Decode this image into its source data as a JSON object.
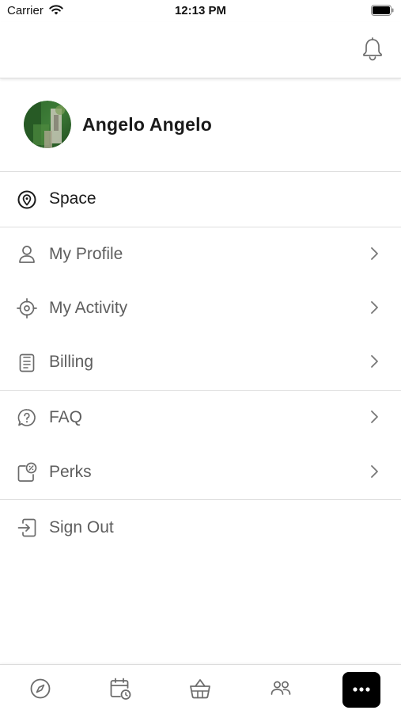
{
  "status_bar": {
    "carrier": "Carrier",
    "time": "12:13 PM"
  },
  "top_bar": {
    "bell_icon": "bell-icon"
  },
  "profile": {
    "name": "Angelo Angelo",
    "avatar": "avatar-photo"
  },
  "menu": {
    "space": {
      "label": "Space",
      "icon": "location-pin-icon"
    },
    "my_profile": {
      "label": "My Profile",
      "icon": "person-icon"
    },
    "my_activity": {
      "label": "My Activity",
      "icon": "crosshair-icon"
    },
    "billing": {
      "label": "Billing",
      "icon": "document-icon"
    },
    "faq": {
      "label": "FAQ",
      "icon": "question-bubble-icon"
    },
    "perks": {
      "label": "Perks",
      "icon": "percent-coupon-icon"
    },
    "sign_out": {
      "label": "Sign Out",
      "icon": "sign-out-icon"
    }
  },
  "tab_bar": {
    "tabs": [
      "compass-icon",
      "calendar-clock-icon",
      "basket-icon",
      "people-icon",
      "more-icon"
    ],
    "active_tab": "more-icon"
  },
  "colors": {
    "text_primary": "#1a1a1a",
    "text_secondary": "#5e5e5e",
    "divider": "#dedede",
    "active_tab_bg": "#000000"
  }
}
